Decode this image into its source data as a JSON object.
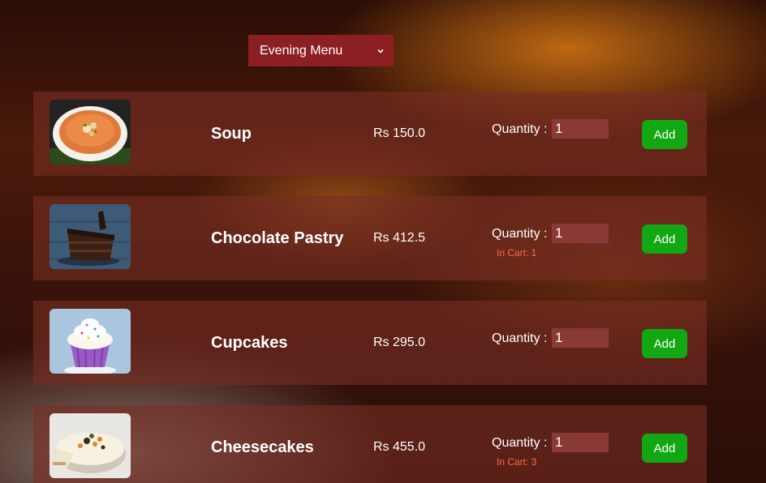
{
  "menu_select": {
    "selected": "Evening Menu",
    "icon": "chevron-down-icon"
  },
  "items": [
    {
      "name": "Soup",
      "price": "Rs 150.0",
      "quantity_label": "Quantity :",
      "quantity": "1",
      "in_cart": "",
      "add_label": "Add",
      "image": "soup-image"
    },
    {
      "name": "Chocolate Pastry",
      "price": "Rs 412.5",
      "quantity_label": "Quantity :",
      "quantity": "1",
      "in_cart": "In Cart: 1",
      "add_label": "Add",
      "image": "chocolate-pastry-image"
    },
    {
      "name": "Cupcakes",
      "price": "Rs 295.0",
      "quantity_label": "Quantity :",
      "quantity": "1",
      "in_cart": "",
      "add_label": "Add",
      "image": "cupcake-image"
    },
    {
      "name": "Cheesecakes",
      "price": "Rs 455.0",
      "quantity_label": "Quantity :",
      "quantity": "1",
      "in_cart": "In Cart: 3",
      "add_label": "Add",
      "image": "cheesecake-image"
    }
  ],
  "colors": {
    "select_bg": "#8c1f24",
    "add_button": "#12a814",
    "in_cart_text": "#ff6b3d",
    "row_bg": "#782d23"
  }
}
